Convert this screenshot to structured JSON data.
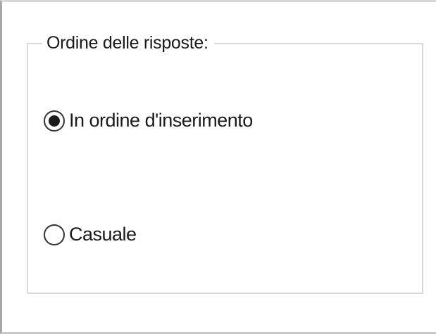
{
  "group": {
    "title": "Ordine delle risposte:",
    "options": [
      {
        "label": "In ordine d'inserimento",
        "selected": true
      },
      {
        "label": "Casuale",
        "selected": false
      }
    ]
  }
}
